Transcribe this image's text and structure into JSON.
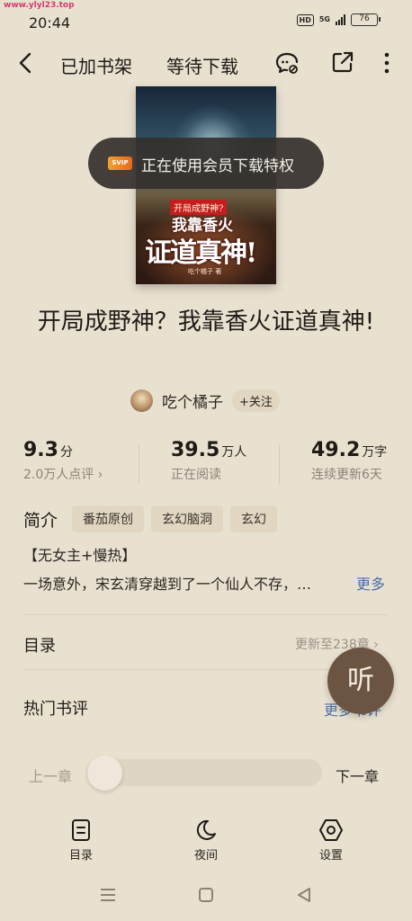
{
  "watermark": "www.ylyl23.top",
  "status_bar": {
    "time": "20:44",
    "hd": "HD",
    "network": "5G",
    "battery": "76"
  },
  "top_bar": {
    "shelf_label": "已加书架",
    "download_label": "等待下载"
  },
  "cover": {
    "subtitle": "开局成野神?",
    "line1": "我靠香火",
    "line2": "证道真神!",
    "author": "吃个橘子 著"
  },
  "toast": {
    "badge": "SVIP",
    "text": "正在使用会员下载特权"
  },
  "book": {
    "title": "开局成野神？我靠香火证道真神!"
  },
  "author": {
    "name": "吃个橘子",
    "follow_label": "+关注"
  },
  "stats": [
    {
      "value": "9.3",
      "unit": "分",
      "sub": "2.0万人点评 ›"
    },
    {
      "value": "39.5",
      "unit": "万人",
      "sub": "正在阅读"
    },
    {
      "value": "49.2",
      "unit": "万字",
      "sub": "连续更新6天"
    }
  ],
  "intro": {
    "label": "简介",
    "tags": [
      "番茄原创",
      "玄幻脑洞",
      "玄幻"
    ],
    "line1": "【无女主+慢热】",
    "line2": "一场意外，宋玄清穿越到了一个仙人不存，…",
    "more_label": "更多"
  },
  "toc": {
    "label": "目录",
    "update": "更新至238章 ›"
  },
  "reviews": {
    "label": "热门书评",
    "more_label": "更多书评"
  },
  "listen_label": "听",
  "chapter_nav": {
    "prev_label": "上一章",
    "next_label": "下一章",
    "progress": 0
  },
  "bottom_nav": [
    {
      "icon": "catalog-icon",
      "label": "目录"
    },
    {
      "icon": "night-mode-icon",
      "label": "夜间"
    },
    {
      "icon": "settings-icon",
      "label": "设置"
    }
  ],
  "colors": {
    "background": "#e9e1d0",
    "link": "#4a6fa8",
    "listen_button": "#6b5542"
  }
}
